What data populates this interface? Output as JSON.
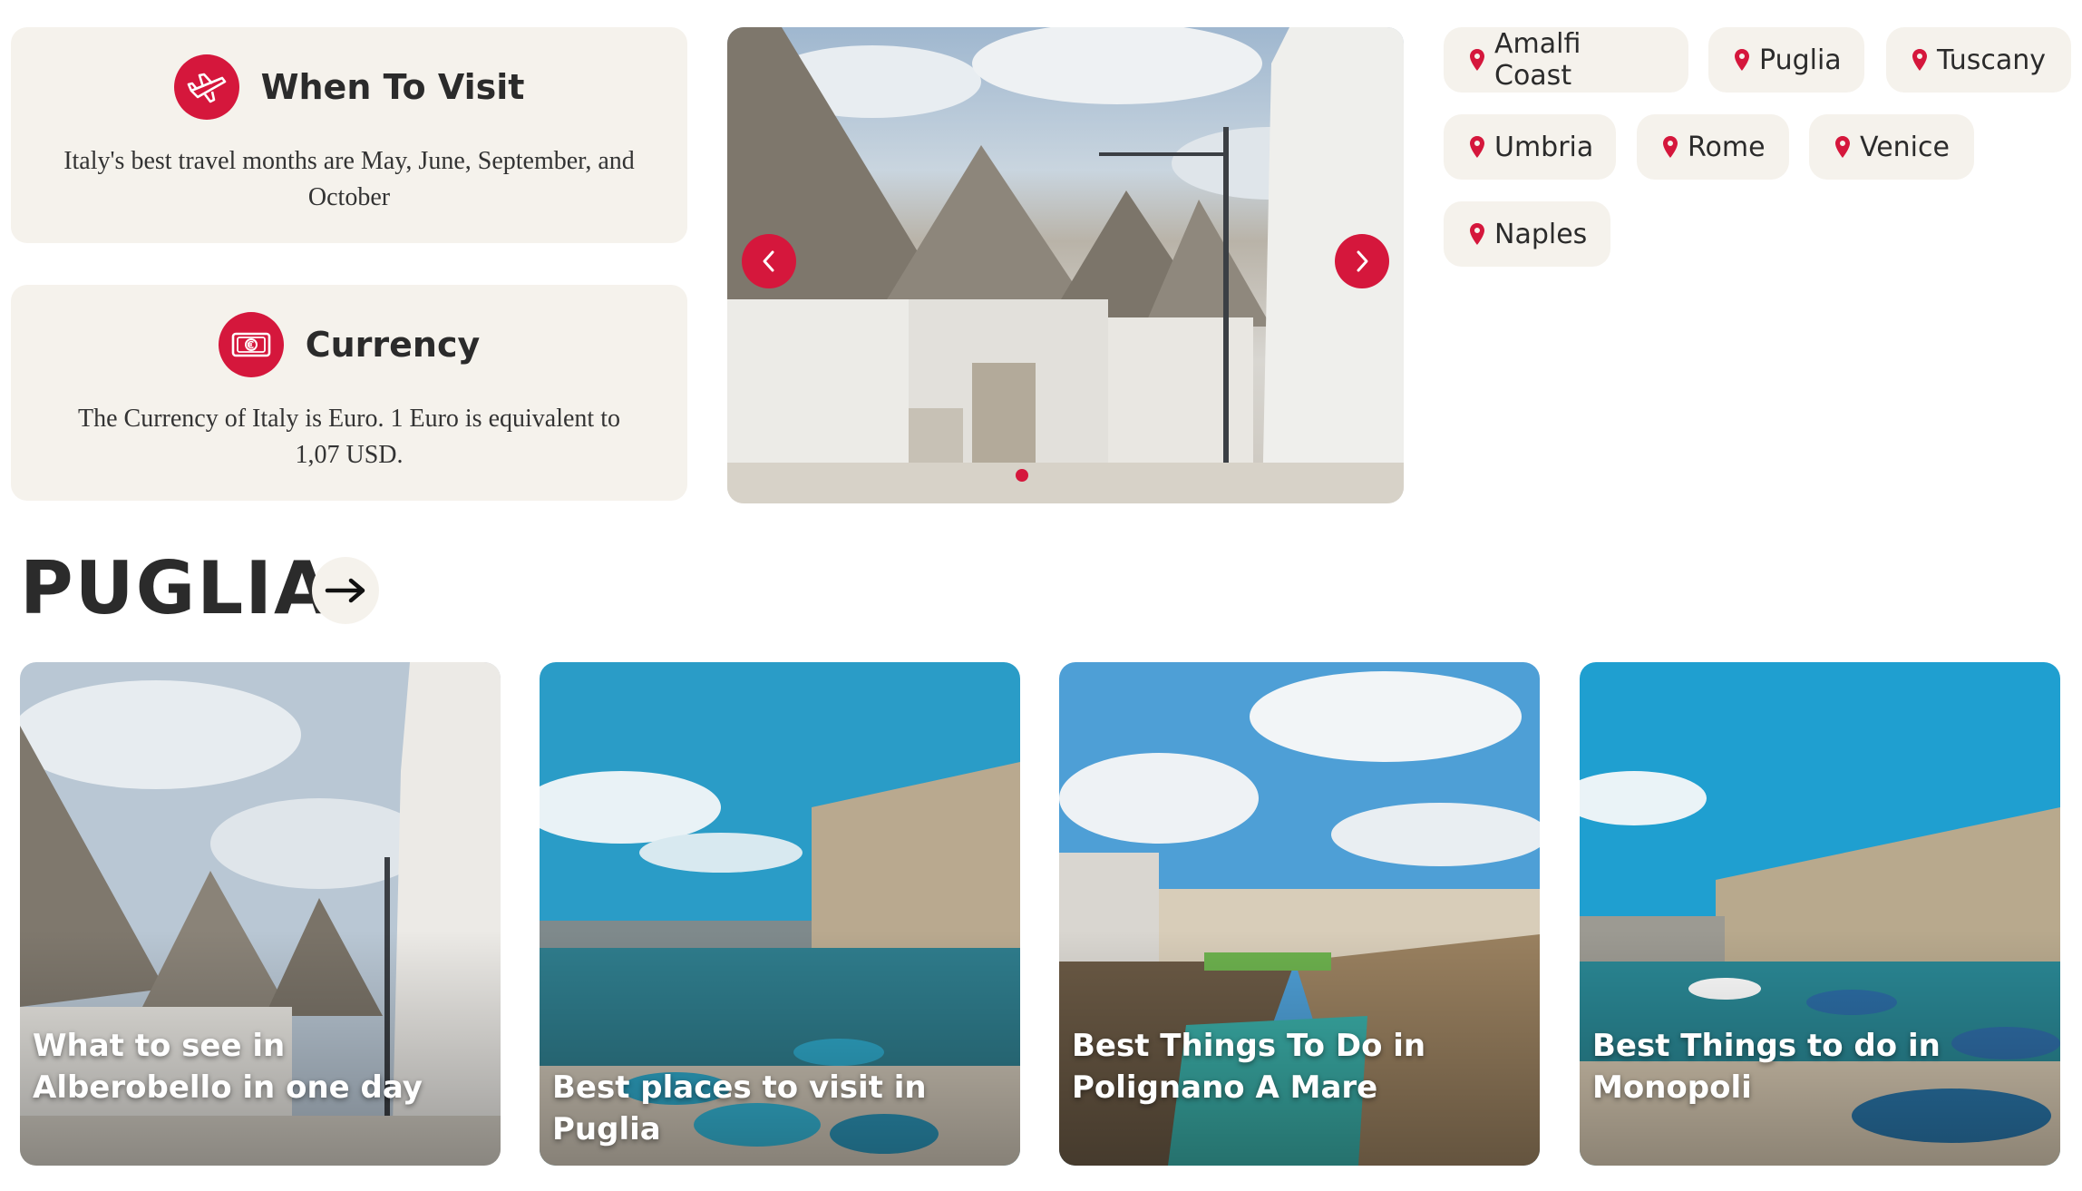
{
  "info_cards": {
    "visit": {
      "title": "When To Visit",
      "text": "Italy's best travel months are May, June, September, and October",
      "icon": "airplane-icon"
    },
    "currency": {
      "title": "Currency",
      "text": "The Currency of Italy is Euro. 1 Euro is equivalent to 1,07 USD.",
      "icon": "euro-banknote-icon"
    }
  },
  "slider": {
    "prev_icon": "chevron-left-icon",
    "next_icon": "chevron-right-icon"
  },
  "regions": [
    "Amalfi Coast",
    "Puglia",
    "Tuscany",
    "Umbria",
    "Rome",
    "Venice",
    "Naples"
  ],
  "section": {
    "title": "PUGLIA",
    "arrow_icon": "arrow-right-icon"
  },
  "posts": [
    {
      "title": "What to see in Alberobello in one day"
    },
    {
      "title": "Best places to visit in Puglia"
    },
    {
      "title": "Best Things To Do in Polignano A Mare"
    },
    {
      "title": "Best Things to do in Monopoli"
    }
  ],
  "colors": {
    "accent": "#d5173c",
    "card_bg": "#f5f2ec",
    "text": "#2b2b2b"
  }
}
